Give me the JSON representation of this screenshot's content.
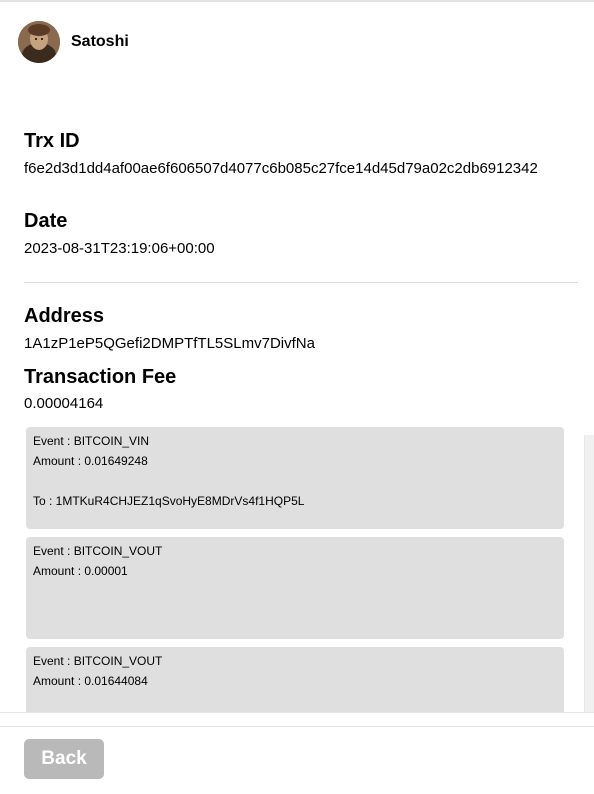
{
  "header": {
    "username": "Satoshi",
    "avatar_icon": "user-portrait-icon"
  },
  "details": {
    "trx_id_label": "Trx ID",
    "trx_id_value": "f6e2d3d1dd4af00ae6f606507d4077c6b085c27fce14d45d79a02c2db6912342",
    "date_label": "Date",
    "date_value": "2023-08-31T23:19:06+00:00",
    "address_label": "Address",
    "address_value": "1A1zP1eP5QGefi2DMPTfTL5SLmv7DivfNa",
    "fee_label": "Transaction Fee",
    "fee_value": "0.00004164"
  },
  "events": [
    {
      "event": "Event : BITCOIN_VIN",
      "amount": "Amount : 0.01649248",
      "to": "To : 1MTKuR4CHJEZ1qSvoHyE8MDrVs4f1HQP5L"
    },
    {
      "event": "Event : BITCOIN_VOUT",
      "amount": "Amount : 0.00001",
      "to": ""
    },
    {
      "event": "Event : BITCOIN_VOUT",
      "amount": "Amount : 0.01644084",
      "to": ""
    }
  ],
  "footer": {
    "back_label": "Back"
  },
  "colors": {
    "card_background": "#e0dfdf",
    "button_background": "#b9b9b9",
    "divider": "#dcdcdc"
  }
}
